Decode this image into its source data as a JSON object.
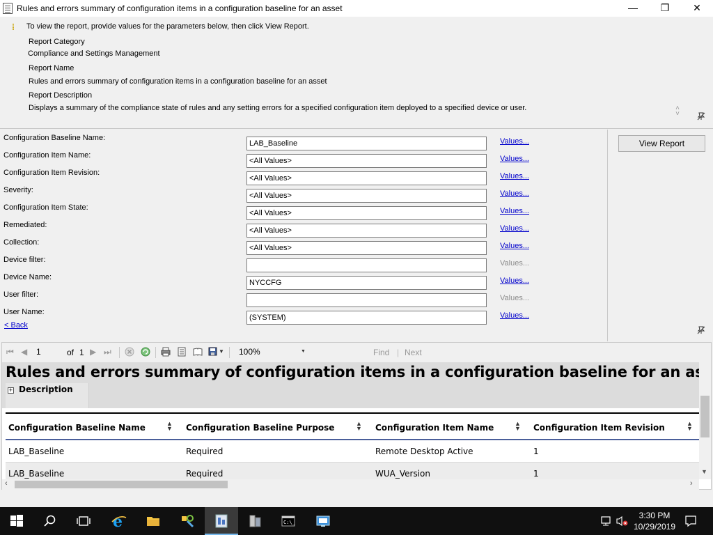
{
  "window": {
    "title": "Rules and errors summary of configuration items in a configuration baseline for an asset",
    "min_glyph": "—",
    "max_glyph": "❐",
    "close_glyph": "✕"
  },
  "info": {
    "instruction": "To view the report, provide values for the parameters below, then click View Report.",
    "category_label": "Report Category",
    "category_value": "Compliance and Settings Management",
    "name_label": "Report Name",
    "name_value": "Rules and errors summary of configuration items in a configuration baseline for an asset",
    "description_label": "Report Description",
    "description_value": "Displays a summary of the compliance state of rules and any setting errors for a specified configuration item deployed to a specified device or user."
  },
  "params": [
    {
      "label": "Configuration Baseline Name:",
      "value": "LAB_Baseline",
      "link": "Values...",
      "link_enabled": true
    },
    {
      "label": "Configuration Item Name:",
      "value": "<All Values>",
      "link": "Values...",
      "link_enabled": true
    },
    {
      "label": "Configuration Item Revision:",
      "value": "<All Values>",
      "link": "Values...",
      "link_enabled": true
    },
    {
      "label": "Severity:",
      "value": "<All Values>",
      "link": "Values...",
      "link_enabled": true
    },
    {
      "label": "Configuration Item State:",
      "value": "<All Values>",
      "link": "Values...",
      "link_enabled": true
    },
    {
      "label": "Remediated:",
      "value": "<All Values>",
      "link": "Values...",
      "link_enabled": true
    },
    {
      "label": "Collection:",
      "value": "<All Values>",
      "link": "Values...",
      "link_enabled": true
    },
    {
      "label": "Device filter:",
      "value": "",
      "link": "Values...",
      "link_enabled": false
    },
    {
      "label": "Device Name:",
      "value": "NYCCFG",
      "link": "Values...",
      "link_enabled": true
    },
    {
      "label": "User filter:",
      "value": "",
      "link": "Values...",
      "link_enabled": false
    },
    {
      "label": "User Name:",
      "value": "(SYSTEM)",
      "link": "Values...",
      "link_enabled": true
    }
  ],
  "back_link": "< Back",
  "view_report_button": "View Report",
  "toolbar": {
    "page_current": "1",
    "page_of": "of",
    "page_total": "1",
    "zoom": "100%",
    "find_label": "Find",
    "next_label": "Next",
    "separator": "|"
  },
  "report": {
    "title": "Rules and errors summary of configuration items in a configuration baseline for an asset",
    "description_toggle": "Description",
    "columns": [
      "Configuration Baseline Name",
      "Configuration Baseline Purpose",
      "Configuration Item Name",
      "Configuration Item Revision"
    ],
    "rows": [
      [
        "LAB_Baseline",
        "Required",
        "Remote Desktop Active",
        "1"
      ],
      [
        "LAB_Baseline",
        "Required",
        "WUA_Version",
        "1"
      ]
    ]
  },
  "taskbar": {
    "time": "3:30 PM",
    "date": "10/29/2019",
    "accent_color": "#76b9ed"
  }
}
